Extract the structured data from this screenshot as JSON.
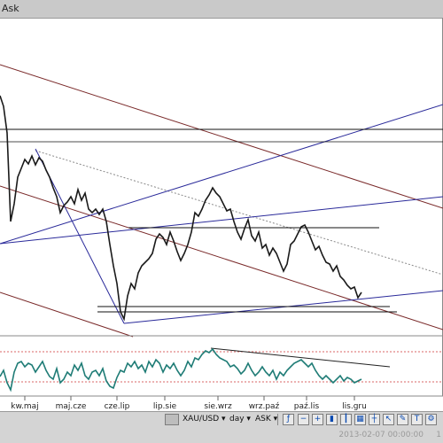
{
  "window": {
    "title": "Ask"
  },
  "chart": {
    "instrument": "XAU/USD",
    "period": "day",
    "side": "ASK",
    "x_labels": [
      "kw.maj",
      "maj.cze",
      "cze.lip",
      "lip.sie",
      "sie.wrz",
      "wrz.paź",
      "paź.lis",
      "lis.gru"
    ]
  },
  "toolbar": {
    "instrument_label": "XAU/USD ▾",
    "period_label": "day ▾",
    "side_label": "ASK ▾"
  },
  "status": {
    "datetime": "2013-02-07 00:00:00",
    "extra": "1"
  }
}
